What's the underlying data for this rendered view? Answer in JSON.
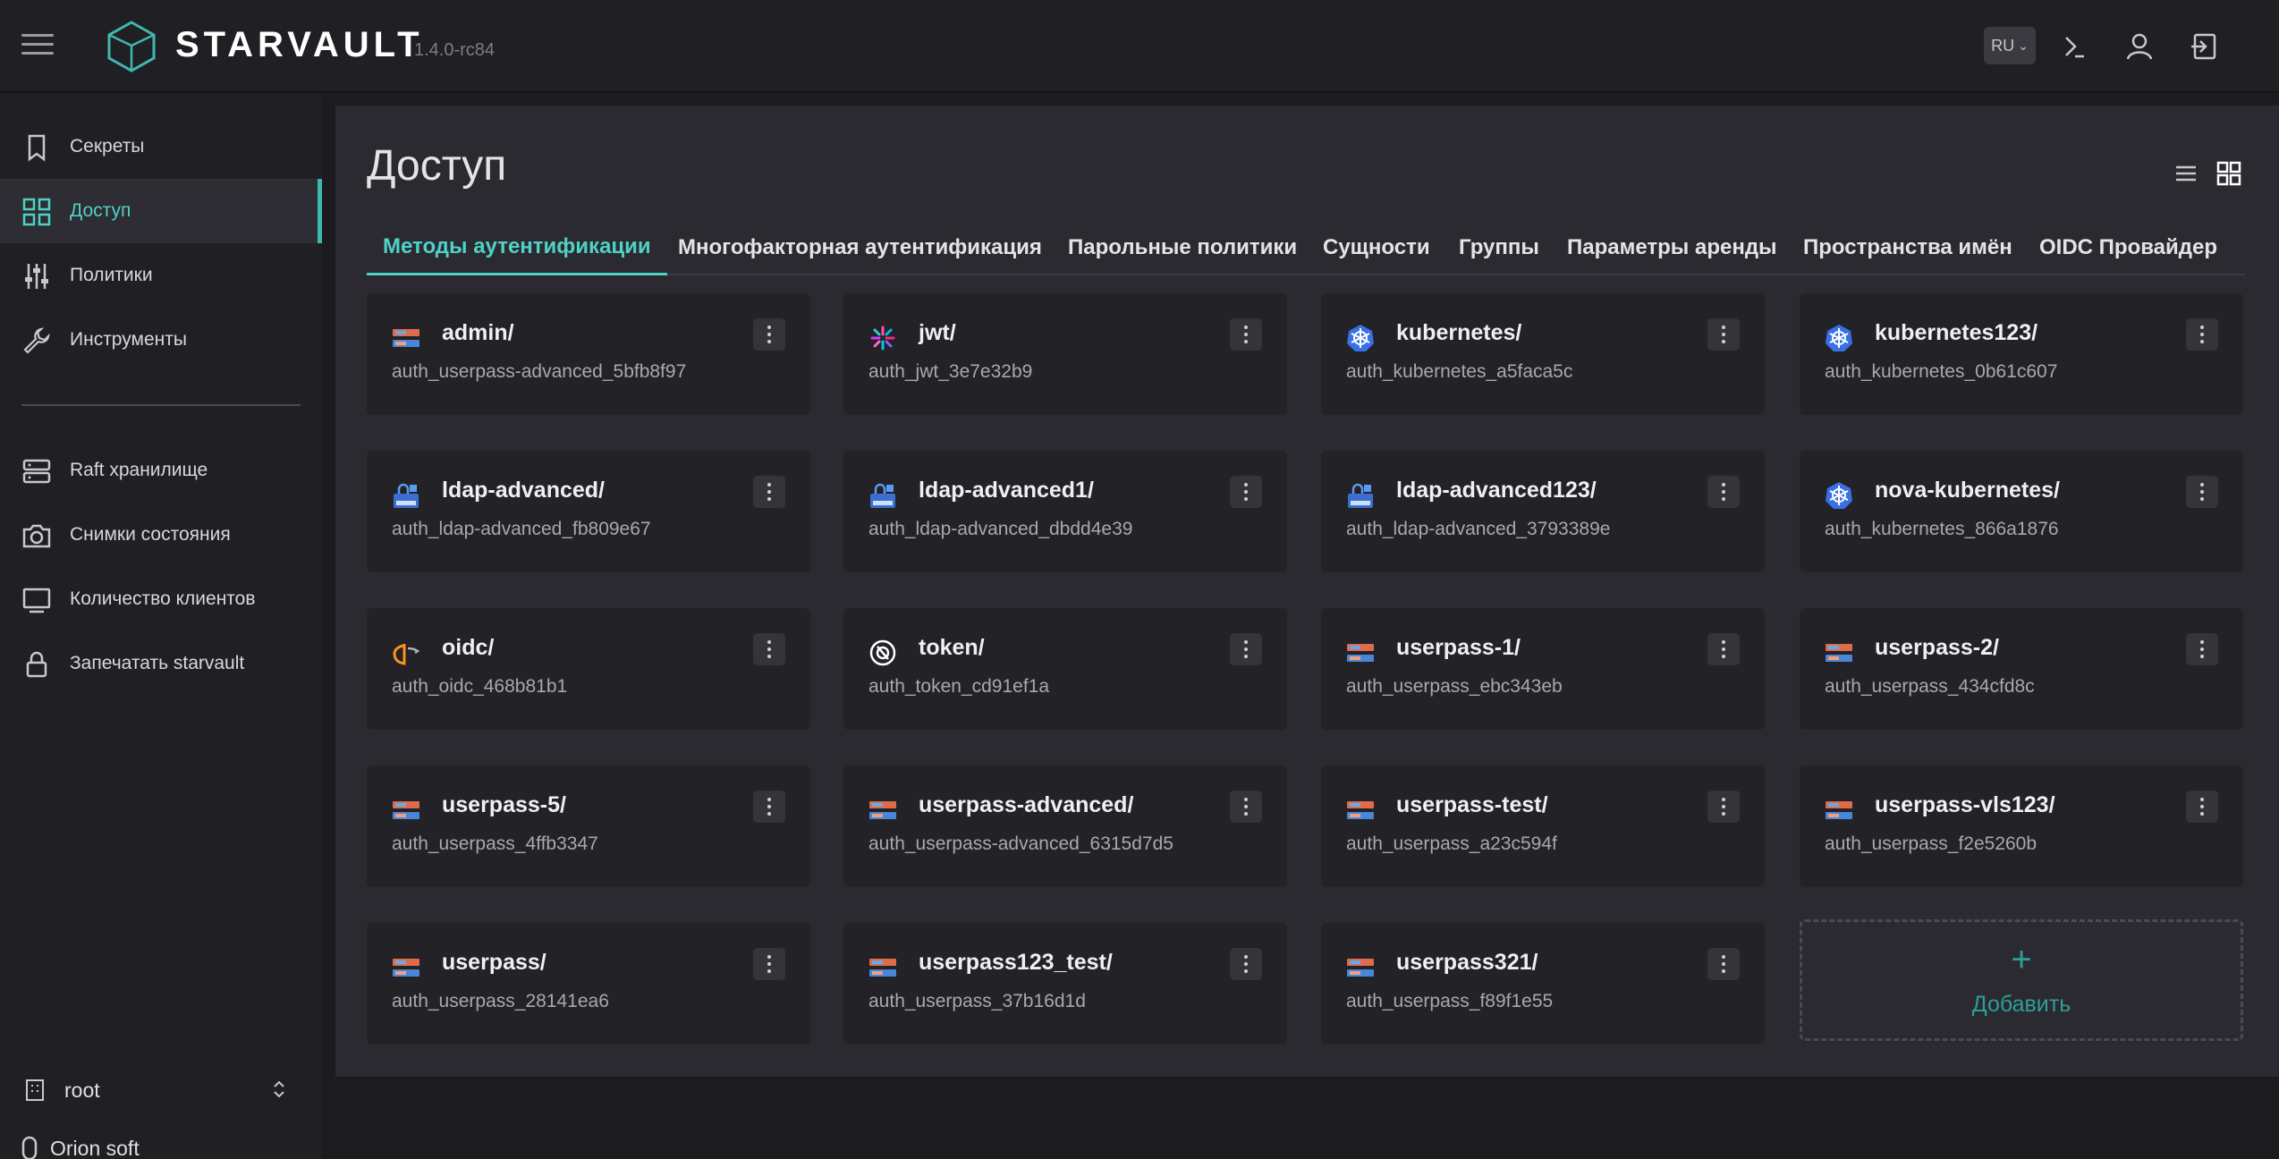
{
  "header": {
    "brand": "STARVAULT",
    "version": "1.4.0-rc84",
    "language": "RU"
  },
  "sidebar": {
    "items": [
      {
        "label": "Секреты",
        "icon": "bookmark-icon"
      },
      {
        "label": "Доступ",
        "icon": "grid-icon"
      },
      {
        "label": "Политики",
        "icon": "sliders-icon"
      },
      {
        "label": "Инструменты",
        "icon": "wrench-icon"
      },
      {
        "label": "Raft хранилище",
        "icon": "server-icon"
      },
      {
        "label": "Снимки состояния",
        "icon": "camera-icon"
      },
      {
        "label": "Количество клиентов",
        "icon": "monitor-icon"
      },
      {
        "label": "Запечатать starvault",
        "icon": "lock-icon"
      }
    ],
    "namespace": "root",
    "organization": "Orion soft"
  },
  "main": {
    "title": "Доступ",
    "tabs": [
      {
        "label": "Методы аутентификации",
        "active": true
      },
      {
        "label": "Многофакторная аутентификация"
      },
      {
        "label": "Парольные политики"
      },
      {
        "label": "Сущности"
      },
      {
        "label": "Группы"
      },
      {
        "label": "Параметры аренды"
      },
      {
        "label": "Пространства имён"
      },
      {
        "label": "OIDC Провайдер"
      }
    ],
    "cards": [
      {
        "name": "admin/",
        "accessor": "auth_userpass-advanced_5bfb8f97",
        "icon": "userpass-icon"
      },
      {
        "name": "jwt/",
        "accessor": "auth_jwt_3e7e32b9",
        "icon": "jwt-icon"
      },
      {
        "name": "kubernetes/",
        "accessor": "auth_kubernetes_a5faca5c",
        "icon": "kubernetes-icon"
      },
      {
        "name": "kubernetes123/",
        "accessor": "auth_kubernetes_0b61c607",
        "icon": "kubernetes-icon"
      },
      {
        "name": "ldap-advanced/",
        "accessor": "auth_ldap-advanced_fb809e67",
        "icon": "ldap-icon"
      },
      {
        "name": "ldap-advanced1/",
        "accessor": "auth_ldap-advanced_dbdd4e39",
        "icon": "ldap-icon"
      },
      {
        "name": "ldap-advanced123/",
        "accessor": "auth_ldap-advanced_3793389e",
        "icon": "ldap-icon"
      },
      {
        "name": "nova-kubernetes/",
        "accessor": "auth_kubernetes_866a1876",
        "icon": "kubernetes-icon"
      },
      {
        "name": "oidc/",
        "accessor": "auth_oidc_468b81b1",
        "icon": "oidc-icon"
      },
      {
        "name": "token/",
        "accessor": "auth_token_cd91ef1a",
        "icon": "token-icon"
      },
      {
        "name": "userpass-1/",
        "accessor": "auth_userpass_ebc343eb",
        "icon": "userpass-icon"
      },
      {
        "name": "userpass-2/",
        "accessor": "auth_userpass_434cfd8c",
        "icon": "userpass-icon"
      },
      {
        "name": "userpass-5/",
        "accessor": "auth_userpass_4ffb3347",
        "icon": "userpass-icon"
      },
      {
        "name": "userpass-advanced/",
        "accessor": "auth_userpass-advanced_6315d7d5",
        "icon": "userpass-icon"
      },
      {
        "name": "userpass-test/",
        "accessor": "auth_userpass_a23c594f",
        "icon": "userpass-icon"
      },
      {
        "name": "userpass-vls123/",
        "accessor": "auth_userpass_f2e5260b",
        "icon": "userpass-icon"
      },
      {
        "name": "userpass/",
        "accessor": "auth_userpass_28141ea6",
        "icon": "userpass-icon"
      },
      {
        "name": "userpass123_test/",
        "accessor": "auth_userpass_37b16d1d",
        "icon": "userpass-icon"
      },
      {
        "name": "userpass321/",
        "accessor": "auth_userpass_f89f1e55",
        "icon": "userpass-icon"
      }
    ],
    "add_label": "Добавить",
    "add_symbol": "+"
  },
  "colors": {
    "accent": "#4fd1c5",
    "add": "#2e9e96",
    "background": "#1c1c20",
    "panel": "#2a2a30",
    "card": "#222227"
  }
}
